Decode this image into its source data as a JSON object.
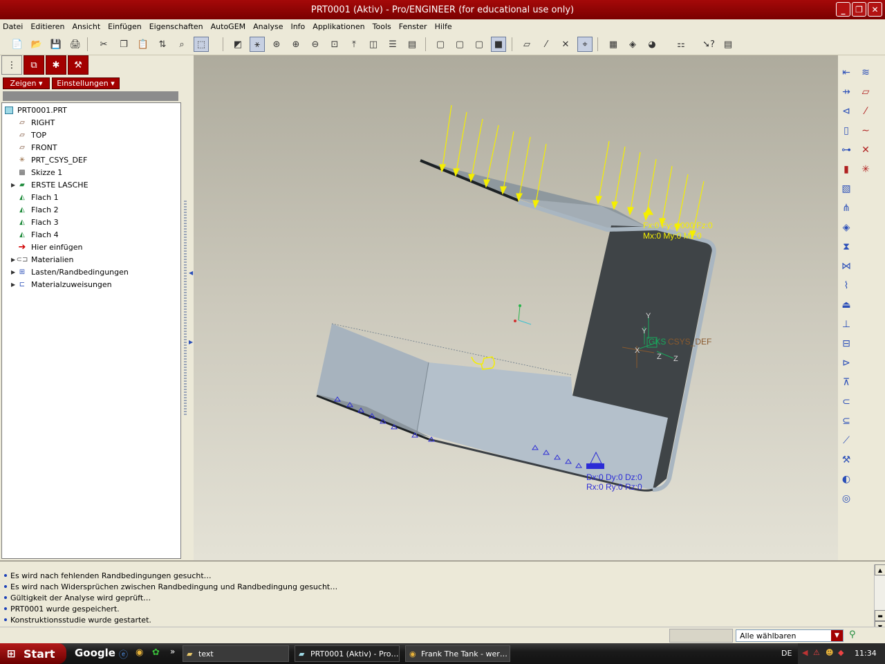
{
  "window": {
    "title": "PRT0001 (Aktiv) - Pro/ENGINEER (for educational use only)"
  },
  "menu": [
    "Datei",
    "Editieren",
    "Ansicht",
    "Einfügen",
    "Eigenschaften",
    "AutoGEM",
    "Analyse",
    "Info",
    "Applikationen",
    "Tools",
    "Fenster",
    "Hilfe"
  ],
  "left_panel": {
    "show_button": "Zeigen",
    "settings_button": "Einstellungen",
    "tree": [
      {
        "label": "PRT0001.PRT",
        "icon": "part-icon",
        "expandable": false
      },
      {
        "label": "RIGHT",
        "icon": "datum-plane-icon",
        "expandable": false
      },
      {
        "label": "TOP",
        "icon": "datum-plane-icon",
        "expandable": false
      },
      {
        "label": "FRONT",
        "icon": "datum-plane-icon",
        "expandable": false
      },
      {
        "label": "PRT_CSYS_DEF",
        "icon": "csys-icon",
        "expandable": false
      },
      {
        "label": "Skizze 1",
        "icon": "sketch-icon",
        "expandable": false
      },
      {
        "label": "ERSTE LASCHE",
        "icon": "sheetmetal-wall-icon",
        "expandable": true
      },
      {
        "label": "Flach 1",
        "icon": "flat-wall-icon",
        "expandable": false
      },
      {
        "label": "Flach 2",
        "icon": "flat-wall-icon",
        "expandable": false
      },
      {
        "label": "Flach 3",
        "icon": "flat-wall-icon",
        "expandable": false
      },
      {
        "label": "Flach 4",
        "icon": "flat-wall-icon",
        "expandable": false
      },
      {
        "label": "Hier einfügen",
        "icon": "insert-arrow-icon",
        "expandable": false
      },
      {
        "label": "Materialien",
        "icon": "materials-icon",
        "expandable": true
      },
      {
        "label": "Lasten/Randbedingungen",
        "icon": "loads-icon",
        "expandable": true
      },
      {
        "label": "Materialzuweisungen",
        "icon": "material-assign-icon",
        "expandable": true
      }
    ]
  },
  "viewport": {
    "load_label_1": "Fx:0 Fy:-1000 Fz:0",
    "load_label_2": "Mx:0 My:0 Mz:0",
    "constraint_label_1": "Dx:0 Dy:0 Dz:0",
    "constraint_label_2": "Rx:0 Ry:0 Rz:0",
    "csys_label": "CSYS_DEF",
    "csys_prefix": "GKS",
    "axis_x": "X",
    "axis_y": "Y",
    "axis_z": "Z",
    "colors": {
      "load": "#f5ef00",
      "constraint": "#2b2bd6",
      "dark_face": "#3f4447",
      "light_face": "#b4c0cb",
      "csys": "#8a5a2e"
    }
  },
  "messages": [
    "Es wird nach fehlenden Randbedingungen gesucht…",
    "Es wird nach Widersprüchen zwischen Randbedingung und Randbedingung gesucht…",
    "Gültigkeit der Analyse wird geprüft…",
    "PRT0001 wurde gespeichert.",
    "Konstruktionsstudie wurde gestartet."
  ],
  "status": {
    "filter_value": "Alle wählbaren"
  },
  "taskbar": {
    "start": "Start",
    "google": "Google",
    "more": "»",
    "items": [
      "text",
      "PRT0001 (Aktiv) - Pro…",
      "Frank The Tank - wer…"
    ],
    "lang": "DE",
    "time": "11:34"
  }
}
